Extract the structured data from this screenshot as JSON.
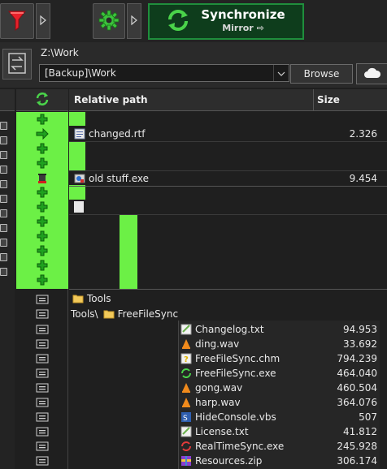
{
  "toolbar": {
    "filter_icon": "filter-funnel-icon",
    "settings_icon": "gear-icon",
    "sync_title": "Synchronize",
    "sync_subtitle": "Mirror ⇨"
  },
  "folder": {
    "base_path": "Z:\\Work",
    "path_value": "[Backup]\\Work",
    "browse_label": "Browse",
    "cloud_icon": "cloud-icon"
  },
  "grid": {
    "header_path": "Relative path",
    "header_size": "Size",
    "rows": [
      {
        "name": "",
        "size": ""
      },
      {
        "name": "changed.rtf",
        "size": "2.326"
      },
      {
        "name": "",
        "size": ""
      },
      {
        "name": "",
        "size": ""
      },
      {
        "name": "old stuff.exe",
        "size": "9.454"
      },
      {
        "name": "",
        "size": ""
      },
      {
        "name": "",
        "size": ""
      },
      {
        "name": "",
        "size": ""
      },
      {
        "name": "",
        "size": ""
      },
      {
        "name": "",
        "size": ""
      },
      {
        "name": "",
        "size": ""
      },
      {
        "name": "",
        "size": ""
      },
      {
        "name": "Tools",
        "size": ""
      },
      {
        "name": "FreeFileSync",
        "prefix": "Tools\\",
        "size": ""
      },
      {
        "name": "Changelog.txt",
        "size": "94.953"
      },
      {
        "name": "ding.wav",
        "size": "33.692"
      },
      {
        "name": "FreeFileSync.chm",
        "size": "794.239"
      },
      {
        "name": "FreeFileSync.exe",
        "size": "464.040"
      },
      {
        "name": "gong.wav",
        "size": "460.504"
      },
      {
        "name": "harp.wav",
        "size": "364.076"
      },
      {
        "name": "HideConsole.vbs",
        "size": "507"
      },
      {
        "name": "License.txt",
        "size": "41.812"
      },
      {
        "name": "RealTimeSync.exe",
        "size": "245.928"
      },
      {
        "name": "Resources.zip",
        "size": "306.174"
      }
    ]
  }
}
